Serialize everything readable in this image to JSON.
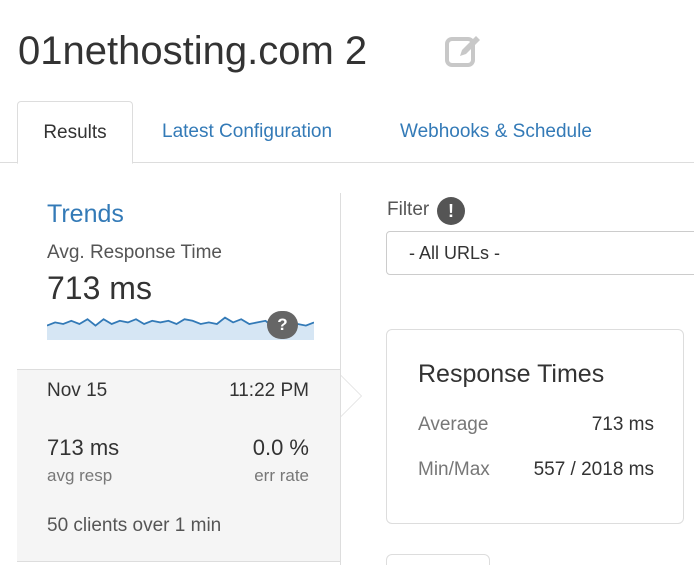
{
  "header": {
    "title": "01nethosting.com 2",
    "edit_icon": "edit-icon"
  },
  "tabs": [
    {
      "label": "Results",
      "active": true
    },
    {
      "label": "Latest Configuration",
      "active": false
    },
    {
      "label": "Webhooks & Schedule",
      "active": false
    }
  ],
  "trends": {
    "title": "Trends",
    "metric_label": "Avg. Response Time",
    "metric_value": "713 ms",
    "help_icon": "?",
    "sparkline_values": [
      0.55,
      0.45,
      0.5,
      0.4,
      0.5,
      0.35,
      0.55,
      0.35,
      0.5,
      0.4,
      0.45,
      0.35,
      0.5,
      0.4,
      0.45,
      0.4,
      0.5,
      0.35,
      0.4,
      0.5,
      0.45,
      0.5,
      0.3,
      0.45,
      0.35,
      0.5,
      0.45,
      0.4,
      0.6,
      0.7,
      0.55,
      0.5,
      0.55,
      0.45
    ],
    "accent_color": "#337ab7",
    "fill_color": "#d6e6f4"
  },
  "detail": {
    "date": "Nov 15",
    "time": "11:22 PM",
    "avg_resp_value": "713 ms",
    "avg_resp_label": "avg resp",
    "err_rate_value": "0.0 %",
    "err_rate_label": "err rate",
    "clients": "50 clients over 1 min"
  },
  "filter": {
    "label": "Filter",
    "info_icon": "!",
    "selected": "- All URLs -"
  },
  "response_times": {
    "title": "Response Times",
    "average_label": "Average",
    "average_value": "713 ms",
    "minmax_label": "Min/Max",
    "minmax_value": "557 / 2018 ms"
  }
}
